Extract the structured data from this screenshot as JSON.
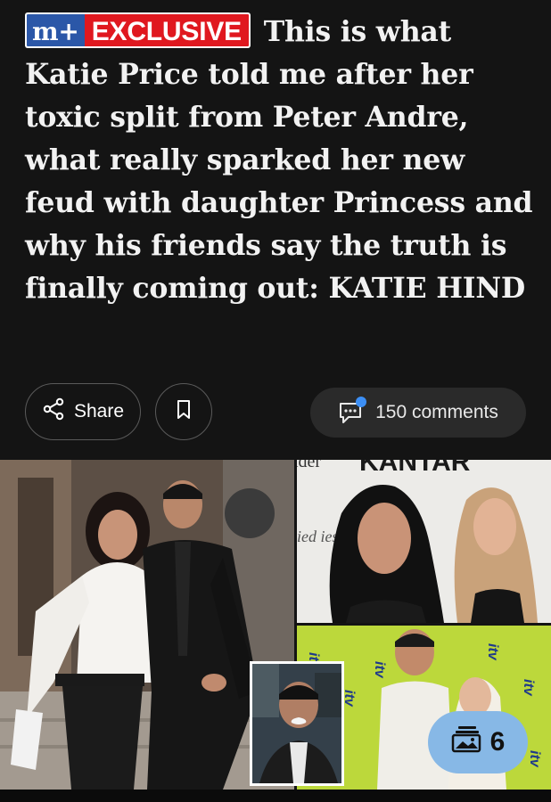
{
  "article": {
    "badge_mplus": "m+",
    "badge_exclusive": "EXCLUSIVE",
    "headline": "This is what Katie Price told me after her toxic split from Peter Andre, what really sparked her new feud with daughter Princess and why his friends say the truth is finally coming out: KATIE HIND"
  },
  "actions": {
    "share_label": "Share",
    "comments_label": "150 comments"
  },
  "gallery": {
    "count": "6",
    "backdrop_text_top": "KANTAR",
    "backdrop_text_side": "ied ies",
    "backdrop_text_corner": "ider",
    "itv_logo_text": "itv"
  },
  "colors": {
    "background": "#141414",
    "badge_blue": "#2b57a8",
    "badge_red": "#e0181f",
    "gallery_button": "#87b8e6",
    "itv_green": "#bcd83b",
    "notification_dot": "#3c8ff5"
  },
  "icons": {
    "share": "share-icon",
    "bookmark": "bookmark-icon",
    "comments": "comment-bubble-icon",
    "gallery": "image-stack-icon"
  }
}
